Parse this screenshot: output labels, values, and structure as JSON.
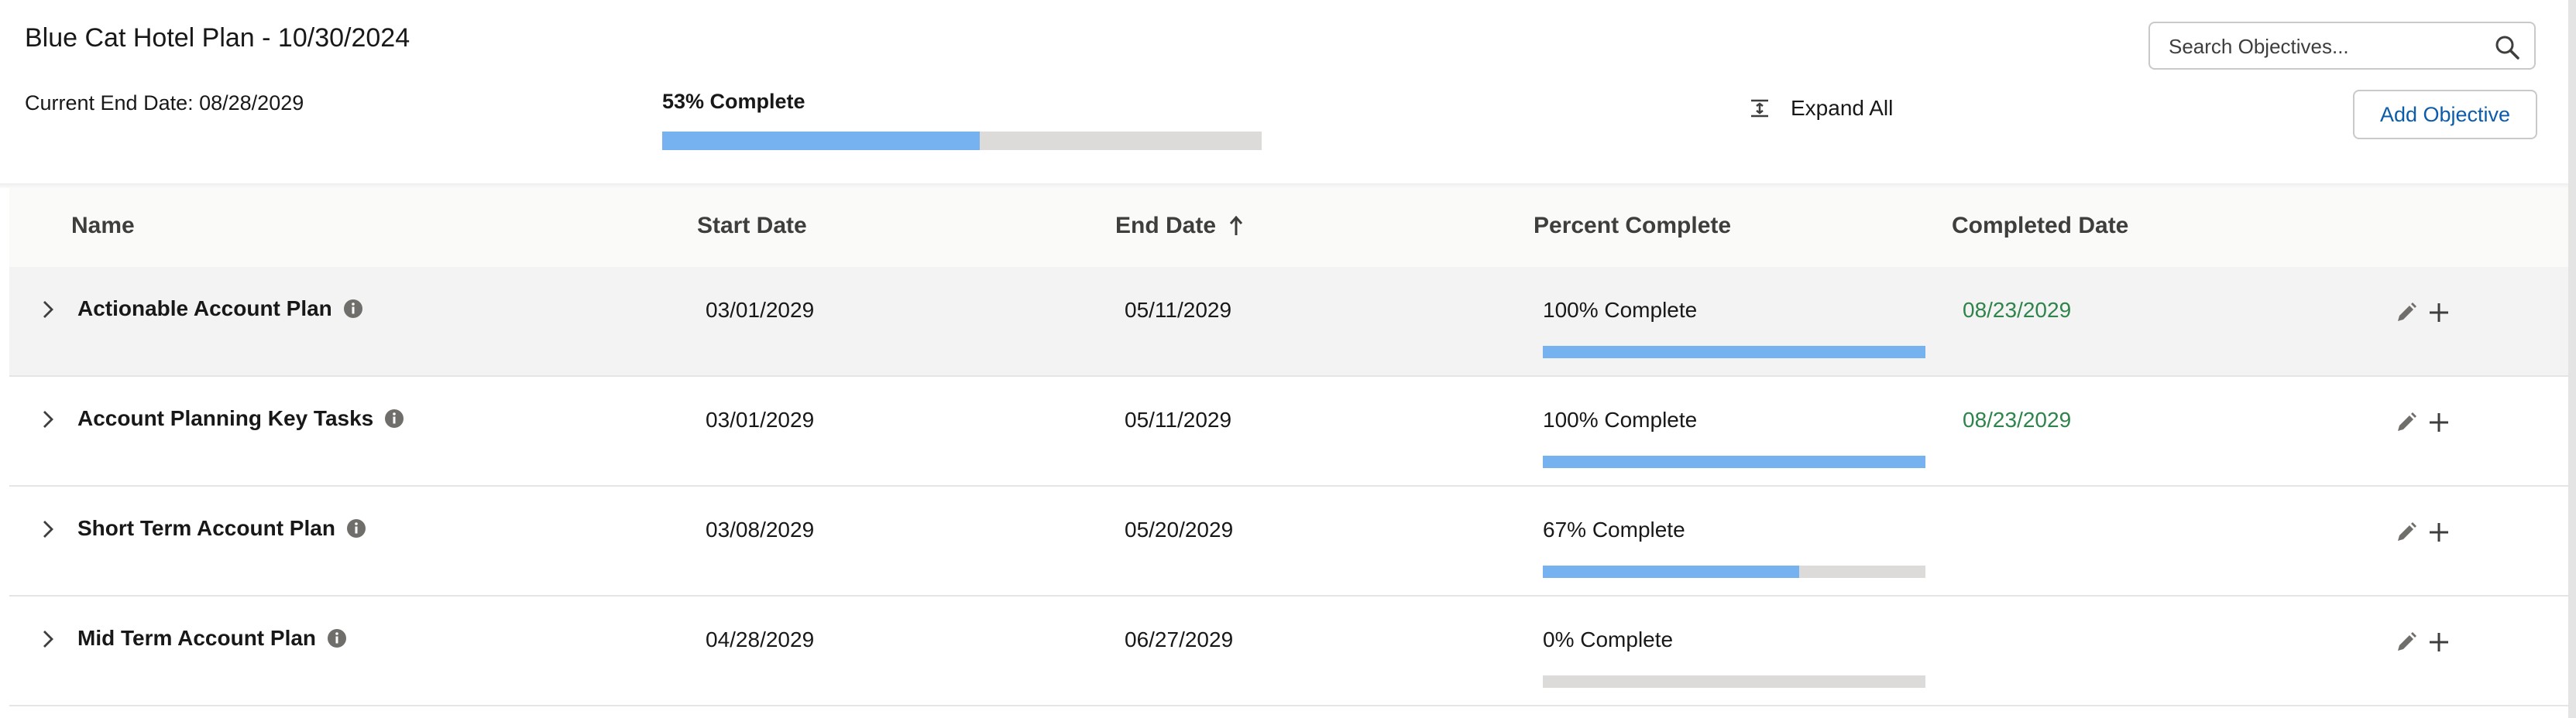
{
  "header": {
    "title": "Blue Cat Hotel Plan - 10/30/2024",
    "current_end_date": "Current End Date: 08/28/2029",
    "overall_progress_label": "53% Complete",
    "overall_progress_fraction": 0.53,
    "expand_all_label": "Expand All",
    "search_placeholder": "Search Objectives...",
    "add_objective_label": "Add Objective"
  },
  "table": {
    "columns": {
      "name": "Name",
      "start_date": "Start Date",
      "end_date": "End Date",
      "percent_complete": "Percent Complete",
      "completed_date": "Completed Date"
    },
    "sorted_column": "end_date",
    "sort_direction": "ascending",
    "rows": [
      {
        "name": "Actionable Account Plan",
        "start_date": "03/01/2029",
        "end_date": "05/11/2029",
        "percent_label": "100% Complete",
        "percent": 100,
        "completed_date": "08/23/2029"
      },
      {
        "name": "Account Planning Key Tasks",
        "start_date": "03/01/2029",
        "end_date": "05/11/2029",
        "percent_label": "100% Complete",
        "percent": 100,
        "completed_date": "08/23/2029"
      },
      {
        "name": "Short Term Account Plan",
        "start_date": "03/08/2029",
        "end_date": "05/20/2029",
        "percent_label": "67% Complete",
        "percent": 67,
        "completed_date": ""
      },
      {
        "name": "Mid Term Account Plan",
        "start_date": "04/28/2029",
        "end_date": "06/27/2029",
        "percent_label": "0% Complete",
        "percent": 0,
        "completed_date": ""
      }
    ]
  },
  "icons": {
    "search": "search-icon",
    "expand_all": "expand-all-icon",
    "row_expand": "chevron-right-icon",
    "info": "info-icon",
    "edit": "pencil-icon",
    "add": "plus-icon",
    "sort": "arrow-up-icon"
  },
  "colors": {
    "progress_fill": "#76b1f0",
    "progress_track": "#dddbda",
    "completed_date": "#2e844a",
    "link_blue": "#0b5cab",
    "selected_row": "#f3f3f3"
  }
}
